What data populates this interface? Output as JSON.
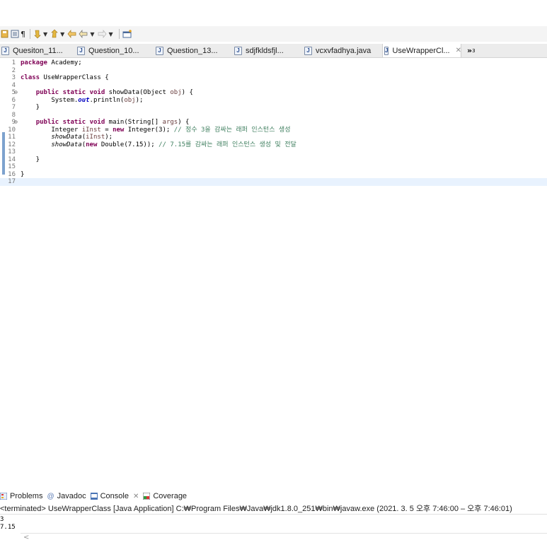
{
  "toolbar": {
    "icons": [
      "save-all-icon",
      "toggle-block-icon",
      "pilcrow-icon",
      "next-annotation-icon",
      "prev-annotation-icon",
      "last-edit-icon",
      "back-icon",
      "forward-icon",
      "pin-editor-icon"
    ]
  },
  "tabs": [
    {
      "label": "Quesiton_11...",
      "active": false
    },
    {
      "label": "Question_10...",
      "active": false
    },
    {
      "label": "Question_13...",
      "active": false
    },
    {
      "label": "sdjfkldsfjl...",
      "active": false
    },
    {
      "label": "vcxvfadhya.java",
      "active": false
    },
    {
      "label": "UseWrapperCl...",
      "active": true
    }
  ],
  "tab_close_glyph": "✕",
  "tab_overflow": {
    "label": "»",
    "count": "3"
  },
  "editor": {
    "lines": [
      {
        "n": "1",
        "tokens": [
          {
            "t": "package",
            "c": "kw"
          },
          {
            "t": " Academy;"
          }
        ]
      },
      {
        "n": "2",
        "tokens": []
      },
      {
        "n": "3",
        "tokens": [
          {
            "t": "class",
            "c": "kw"
          },
          {
            "t": " UseWrapperClass {"
          }
        ]
      },
      {
        "n": "4",
        "tokens": []
      },
      {
        "n": "5",
        "fold": true,
        "tokens": [
          {
            "t": "    "
          },
          {
            "t": "public",
            "c": "kw"
          },
          {
            "t": " "
          },
          {
            "t": "static",
            "c": "kw"
          },
          {
            "t": " "
          },
          {
            "t": "void",
            "c": "kw"
          },
          {
            "t": " showData(Object "
          },
          {
            "t": "obj",
            "c": "param"
          },
          {
            "t": ") {"
          }
        ]
      },
      {
        "n": "6",
        "tokens": [
          {
            "t": "        System."
          },
          {
            "t": "out",
            "c": "fld"
          },
          {
            "t": ".println("
          },
          {
            "t": "obj",
            "c": "param"
          },
          {
            "t": ");"
          }
        ]
      },
      {
        "n": "7",
        "tokens": [
          {
            "t": "    }"
          }
        ]
      },
      {
        "n": "8",
        "tokens": []
      },
      {
        "n": "9",
        "fold": true,
        "tokens": [
          {
            "t": "    "
          },
          {
            "t": "public",
            "c": "kw"
          },
          {
            "t": " "
          },
          {
            "t": "static",
            "c": "kw"
          },
          {
            "t": " "
          },
          {
            "t": "void",
            "c": "kw"
          },
          {
            "t": " main(String[] "
          },
          {
            "t": "args",
            "c": "param"
          },
          {
            "t": ") {"
          }
        ]
      },
      {
        "n": "10",
        "tokens": [
          {
            "t": "        Integer "
          },
          {
            "t": "iInst",
            "c": "param"
          },
          {
            "t": " = "
          },
          {
            "t": "new",
            "c": "kw"
          },
          {
            "t": " Integer(3); "
          },
          {
            "t": "// 정수 3을 감싸는 래퍼 인스턴스 생성",
            "c": "cmt"
          }
        ]
      },
      {
        "n": "11",
        "tokens": [
          {
            "t": "        "
          },
          {
            "t": "showData",
            "c": "stat"
          },
          {
            "t": "("
          },
          {
            "t": "iInst",
            "c": "param"
          },
          {
            "t": ");"
          }
        ]
      },
      {
        "n": "12",
        "tokens": [
          {
            "t": "        "
          },
          {
            "t": "showData",
            "c": "stat"
          },
          {
            "t": "("
          },
          {
            "t": "new",
            "c": "kw"
          },
          {
            "t": " Double(7.15)); "
          },
          {
            "t": "// 7.15를 감싸는 래퍼 인스턴스 생성 및 전달",
            "c": "cmt"
          }
        ]
      },
      {
        "n": "13",
        "tokens": []
      },
      {
        "n": "14",
        "tokens": [
          {
            "t": "    }"
          }
        ]
      },
      {
        "n": "15",
        "tokens": []
      },
      {
        "n": "16",
        "tokens": [
          {
            "t": "}"
          }
        ]
      },
      {
        "n": "17",
        "current": true,
        "tokens": []
      }
    ],
    "hscroll_arrow": "<"
  },
  "console": {
    "tabs": [
      {
        "label": "Problems",
        "icon": "problems-icon"
      },
      {
        "label": "Javadoc",
        "icon": "javadoc-icon"
      },
      {
        "label": "Console",
        "icon": "console-icon",
        "active": true
      },
      {
        "label": "Coverage",
        "icon": "coverage-icon"
      }
    ],
    "console_close_glyph": "✕",
    "header": "<terminated> UseWrapperClass [Java Application] C:₩Program Files₩Java₩jdk1.8.0_251₩bin₩javaw.exe  (2021. 3. 5 오후 7:46:00 – 오후 7:46:01)",
    "output": [
      "3",
      "7.15"
    ]
  }
}
